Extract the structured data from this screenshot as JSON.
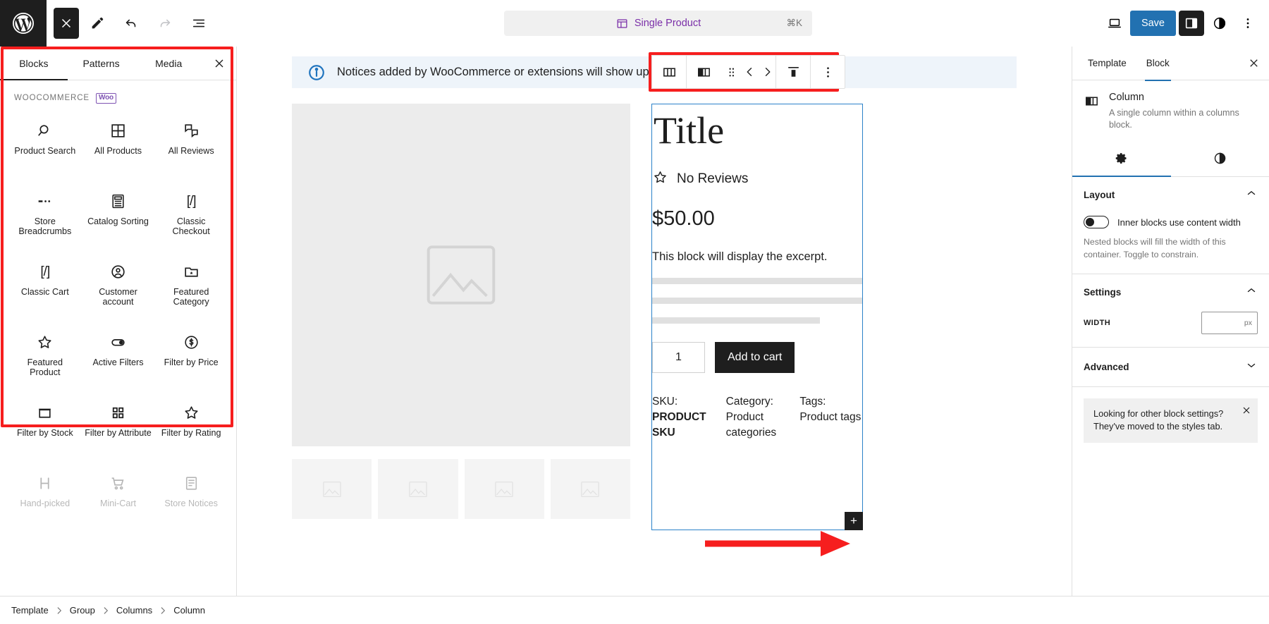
{
  "header": {
    "logo_icon": "wordpress-logo",
    "close_label": "Close",
    "edit_icon": "pencil-icon",
    "undo_icon": "undo-icon",
    "redo_icon": "redo-icon",
    "list_view_icon": "list-view-icon",
    "command_bar": {
      "icon": "template-icon",
      "label": "Single Product",
      "shortcut": "⌘K"
    },
    "view_icon": "desktop-icon",
    "save_label": "Save",
    "settings_icon": "settings-sidebar-icon",
    "styles_icon": "styles-contrast-icon",
    "options_icon": "more-options-icon"
  },
  "inserter": {
    "tabs": [
      {
        "label": "Blocks",
        "selected": true
      },
      {
        "label": "Patterns",
        "selected": false
      },
      {
        "label": "Media",
        "selected": false
      }
    ],
    "close_icon": "close-icon",
    "category": {
      "title": "WOOCOMMERCE",
      "badge": "Woo"
    },
    "blocks": [
      {
        "label": "Product Search",
        "icon": "search-icon",
        "faded": false
      },
      {
        "label": "All Products",
        "icon": "grid-icon",
        "faded": false
      },
      {
        "label": "All Reviews",
        "icon": "comments-icon",
        "faded": false
      },
      {
        "label": "Store Breadcrumbs",
        "icon": "dots-icon",
        "faded": false
      },
      {
        "label": "Catalog Sorting",
        "icon": "calculator-icon",
        "faded": false
      },
      {
        "label": "Classic Checkout",
        "icon": "shortcode-icon",
        "faded": false
      },
      {
        "label": "Classic Cart",
        "icon": "shortcode-icon",
        "faded": false
      },
      {
        "label": "Customer account",
        "icon": "user-circle-icon",
        "faded": false
      },
      {
        "label": "Featured Category",
        "icon": "folder-star-icon",
        "faded": false
      },
      {
        "label": "Featured Product",
        "icon": "star-outline-icon",
        "faded": false
      },
      {
        "label": "Active Filters",
        "icon": "toggle-icon",
        "faded": false
      },
      {
        "label": "Filter by Price",
        "icon": "dollar-circle-icon",
        "faded": false
      },
      {
        "label": "Filter by Stock",
        "icon": "box-icon",
        "faded": false
      },
      {
        "label": "Filter by Attribute",
        "icon": "four-squares-icon",
        "faded": false
      },
      {
        "label": "Filter by Rating",
        "icon": "star-outline-icon",
        "faded": false
      },
      {
        "label": "Hand-picked",
        "icon": "handpicked-icon",
        "faded": true
      },
      {
        "label": "Mini-Cart",
        "icon": "cart-icon",
        "faded": true
      },
      {
        "label": "Store Notices",
        "icon": "notices-icon",
        "faded": true
      }
    ]
  },
  "canvas": {
    "notice": {
      "icon": "info-icon",
      "text": "Notices added by WooCommerce or extensions will show up here."
    },
    "block_toolbar": {
      "parent_icon": "columns-parent-icon",
      "block_icon": "column-block-icon",
      "drag_icon": "drag-handle-icon",
      "prev_icon": "move-left-icon",
      "next_icon": "move-right-icon",
      "align_icon": "align-icon",
      "more_icon": "more-options-icon"
    },
    "gallery": {
      "placeholder_icon": "image-placeholder-icon",
      "thumb_count": 4
    },
    "product": {
      "title": "Title",
      "reviews_icon": "star-outline-icon",
      "reviews_text": "No Reviews",
      "price": "$50.00",
      "excerpt": "This block will display the excerpt.",
      "quantity": "1",
      "add_to_cart_label": "Add to cart",
      "meta": [
        {
          "key": "SKU:",
          "value": "PRODUCT SKU",
          "bold": true
        },
        {
          "key": "Category:",
          "value": "Product categories",
          "bold": false
        },
        {
          "key": "Tags:",
          "value": "Product tags",
          "bold": false
        }
      ],
      "appender_label": "+"
    }
  },
  "settings": {
    "tabs": [
      {
        "label": "Template",
        "selected": false
      },
      {
        "label": "Block",
        "selected": true
      }
    ],
    "close_icon": "close-icon",
    "block_card": {
      "icon": "column-block-icon",
      "name": "Column",
      "description": "A single column within a columns block."
    },
    "pane_tabs": [
      {
        "icon": "gear-icon",
        "selected": true
      },
      {
        "icon": "styles-contrast-icon",
        "selected": false
      }
    ],
    "layout": {
      "title": "Layout",
      "chevron": "chevron-up-icon",
      "toggle_label": "Inner blocks use content width",
      "toggle_on": false,
      "help": "Nested blocks will fill the width of this container. Toggle to constrain."
    },
    "settings_section": {
      "title": "Settings",
      "chevron": "chevron-up-icon",
      "width_label": "WIDTH",
      "width_value": "",
      "width_unit": "px"
    },
    "advanced": {
      "title": "Advanced",
      "chevron": "chevron-down-icon"
    },
    "info_card": {
      "text": "Looking for other block settings? They've moved to the styles tab.",
      "close_icon": "close-icon"
    }
  },
  "footer": {
    "crumbs": [
      "Template",
      "Group",
      "Columns",
      "Column"
    ],
    "separator_icon": "chevron-right-icon"
  },
  "colors": {
    "accent": "#2271b1",
    "highlight_red": "#f61e1e",
    "woo_purple": "#7f54b3",
    "command_purple": "#7a2ea8",
    "selection_blue": "#2b82c9"
  }
}
